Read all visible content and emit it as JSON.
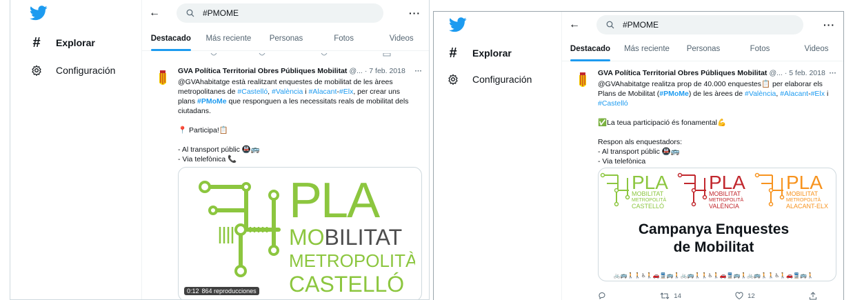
{
  "panel1": {
    "sidebar": {
      "explore_label": "Explorar",
      "settings_label": "Configuración"
    },
    "search": {
      "value": "#PMOME"
    },
    "tabs": [
      "Destacado",
      "Más reciente",
      "Personas",
      "Fotos",
      "Videos"
    ],
    "tweet": {
      "author": "GVA Política Territorial Obres Públiques Mobilitat",
      "handle": "@...",
      "time": "· 7 feb. 2018",
      "more": "···",
      "line1": "@GVAhabitatge està realitzant enquestes de mobilitat de les àrees",
      "line2_pre": "metropolitanes de ",
      "line2_tag1": "#Castelló",
      "line2_sep1": ", ",
      "line2_tag2": "#València",
      "line2_sep2": " i ",
      "line2_tag3": "#Alacant",
      "line2_sep3": "-",
      "line2_tag4": "#Elx",
      "line2_post": ", per crear uns",
      "line3_pre": "plans ",
      "line3_tag": "#PMoMe",
      "line3_post": " que responguen a les necessitats reals de mobilitat dels",
      "line4": "ciutadans.",
      "line5": "📍 Participa!📋",
      "line6": "- Al transport públic 🚇🚌",
      "line7": "- Via telefònica 📞",
      "media": {
        "letters": "PLA",
        "line_a_hi": "MO",
        "line_a_rest": "BILITAT",
        "line_b_hi": "ME",
        "line_b_rest": "TROPOLITÀ",
        "line_c": "CASTELLÓ",
        "video_time": "0:12",
        "views": "864 reproducciones"
      }
    }
  },
  "panel2": {
    "sidebar": {
      "explore_label": "Explorar",
      "settings_label": "Configuración"
    },
    "search": {
      "value": "#PMOME"
    },
    "tabs": [
      "Destacado",
      "Más reciente",
      "Personas",
      "Fotos",
      "Videos"
    ],
    "tweet": {
      "author": "GVA Política Territorial Obres Públiques Mobilitat",
      "handle": "@...",
      "time": "· 5 feb. 2018",
      "more": "···",
      "line1": "@GVAhabitatge realitza prop de 40.000 enquestes📋 per elaborar els",
      "line2_pre": "Plans de Mobilitat (",
      "line2_tag1": "#PMoMe",
      "line2_mid": ") de les àrees de ",
      "line2_tag2": "#València",
      "line2_sep": ", ",
      "line2_tag3": "#Alacant",
      "line2_sep2": "-",
      "line2_tag4": "#Elx",
      "line2_post": " i",
      "line3_tag": "#Castelló",
      "line4": "✅La teua participació és fonamental💪",
      "line5": "Respon als enquestadors:",
      "line6": "- Al transport públic 🚇🚌",
      "line7": "- Via telefònica",
      "media": {
        "pla": "PLA",
        "mob": "MOBILITAT",
        "met": "METROPOLITÀ",
        "city1": "CASTELLÓ",
        "city2": "VALÈNCIA",
        "city3": "ALACANT-ELX",
        "headline1": "Campanya Enquestes",
        "headline2": "de Mobilitat",
        "icon_strip": "🚲🚌🚶🚶♿🚶🚗🚆🚌🚶🚲🚌🚶🚶♿🚶🚗🚆🚌🚶🚲🚌🚶🚶♿🚶🚗🚆🚌🚶"
      },
      "retweets": "14",
      "likes": "12"
    }
  },
  "colors": {
    "twitter_blue": "#1d9bf0",
    "castello_green": "#8cc63f",
    "valencia_red": "#c1272d",
    "alacant_orange": "#f7931e"
  }
}
